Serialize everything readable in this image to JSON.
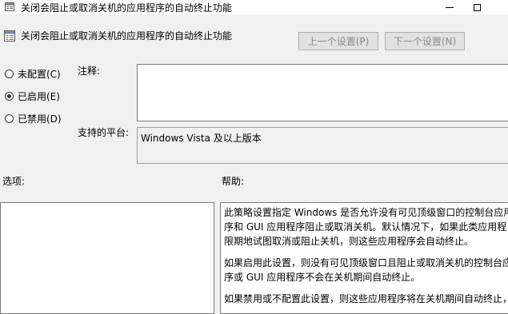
{
  "window": {
    "title": "关闭会阻止或取消关机的应用程序的自动终止功能"
  },
  "policy": {
    "title": "关闭会阻止或取消关机的应用程序的自动终止功能"
  },
  "nav": {
    "prev_label": "上一个设置(P)",
    "next_label": "下一个设置(N)"
  },
  "state": {
    "options": [
      {
        "label": "未配置(C)",
        "checked": false
      },
      {
        "label": "已启用(E)",
        "checked": true
      },
      {
        "label": "已禁用(D)",
        "checked": false
      }
    ]
  },
  "comment": {
    "label": "注释:",
    "value": ""
  },
  "platform": {
    "label": "支持的平台:",
    "value": "Windows Vista 及以上版本"
  },
  "options_section": {
    "label": "选项:"
  },
  "help": {
    "label": "帮助:",
    "paragraphs": [
      [
        "此策略设置指定 Windows 是否允许没有可见顶级窗口的控制台应用",
        "序和 GUI 应用程序阻止或取消关机。默认情况下，如果此类应用程",
        "限期地试图取消或阻止关机，则这些应用程序会自动终止。"
      ],
      [
        "如果启用此设置，则没有可见顶级窗口且阻止或取消关机的控制台应",
        "序或 GUI 应用程序不会在关机期间自动终止。"
      ],
      [
        "如果禁用或不配置此设置，则这些应用程序将在关机期间自动终止，"
      ]
    ]
  }
}
